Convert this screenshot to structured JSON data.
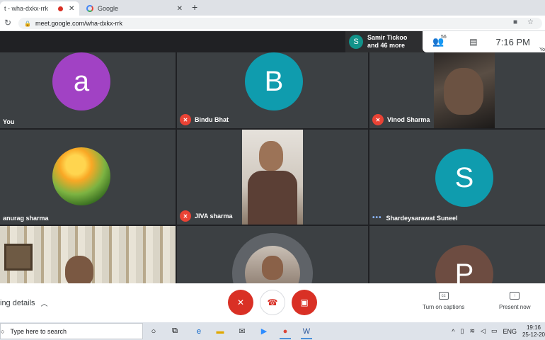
{
  "browser": {
    "tabs": [
      {
        "title": "t - wha-dxkx-rrk",
        "recording": true
      },
      {
        "title": "Google"
      }
    ],
    "new_tab": "+",
    "close": "✕",
    "url": "meet.google.com/wha-dxkx-rrk"
  },
  "meet": {
    "participants": [
      {
        "name": "You",
        "initial": "a",
        "color": "#a142c4"
      },
      {
        "name": "Bindu Bhat",
        "initial": "B",
        "color": "#0f9cae"
      },
      {
        "name": "Vinod Sharma"
      },
      {
        "name": "anurag sharma"
      },
      {
        "name": "JIVA sharma"
      },
      {
        "name": "Shardeysarawat Suneel",
        "initial": "S",
        "color": "#0f9cae"
      },
      {
        "name": "",
        "initial": "P",
        "color": "#6d4c41"
      }
    ],
    "summary": {
      "initial": "S",
      "line1": "Samir Tickoo",
      "line2": "and 46 more"
    },
    "people_count": "56",
    "clock": "7:16 PM",
    "you_label": "Yo"
  },
  "bottom": {
    "details": "ing details",
    "captions": "Turn on captions",
    "present": "Present now"
  },
  "taskbar": {
    "search_placeholder": "Type here to search",
    "language": "ENG",
    "time": "19:16",
    "date": "25-12-20"
  }
}
